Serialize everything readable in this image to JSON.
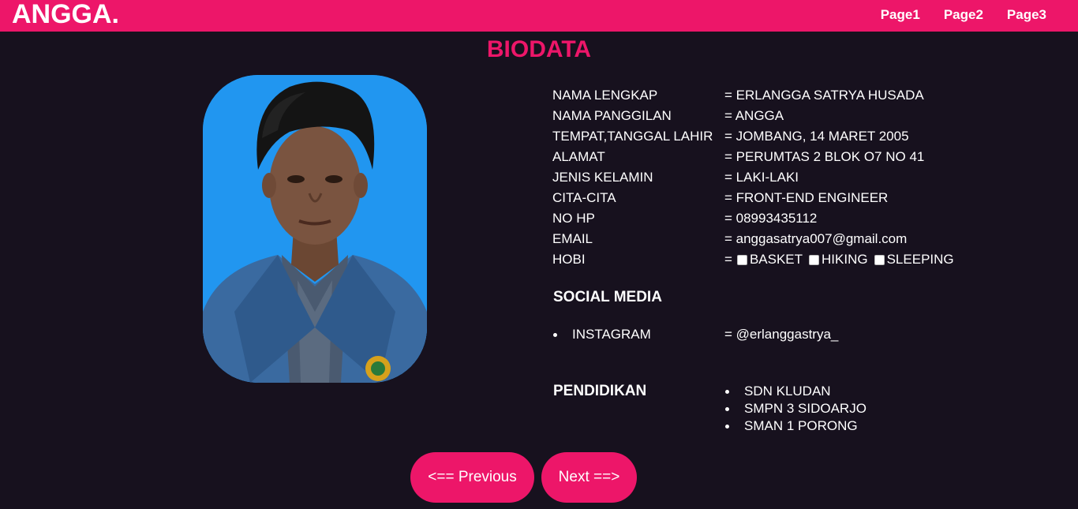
{
  "brand": "ANGGA.",
  "nav": [
    "Page1",
    "Page2",
    "Page3"
  ],
  "title": "BIODATA",
  "fields": [
    {
      "label": "NAMA LENGKAP",
      "value": "= ERLANGGA SATRYA HUSADA"
    },
    {
      "label": "NAMA PANGGILAN",
      "value": "= ANGGA"
    },
    {
      "label": "TEMPAT,TANGGAL LAHIR",
      "value": "= JOMBANG, 14 MARET 2005"
    },
    {
      "label": "ALAMAT",
      "value": "= PERUMTAS 2 BLOK O7 NO 41"
    },
    {
      "label": "JENIS KELAMIN",
      "value": "= LAKI-LAKI"
    },
    {
      "label": "CITA-CITA",
      "value": "= FRONT-END ENGINEER"
    },
    {
      "label": "NO HP",
      "value": "= 08993435112"
    },
    {
      "label": "EMAIL",
      "value": "= anggasatrya007@gmail.com"
    }
  ],
  "hobby": {
    "label": "HOBI",
    "eq": "=",
    "options": [
      {
        "label": "BASKET",
        "checked": false
      },
      {
        "label": "HIKING",
        "checked": false
      },
      {
        "label": "SLEEPING",
        "checked": false
      }
    ]
  },
  "social": {
    "heading": "SOCIAL MEDIA",
    "items": [
      {
        "label": "INSTAGRAM",
        "value": "= @erlanggastrya_"
      }
    ]
  },
  "education": {
    "heading": "PENDIDIKAN",
    "items": [
      "SDN KLUDAN",
      "SMPN 3 SIDOARJO",
      "SMAN 1 PORONG"
    ]
  },
  "buttons": {
    "prev": "<== Previous",
    "next": "Next ==>"
  },
  "colors": {
    "accent": "#ed1669",
    "background": "#17111e",
    "photo_bg": "#2196f0"
  }
}
